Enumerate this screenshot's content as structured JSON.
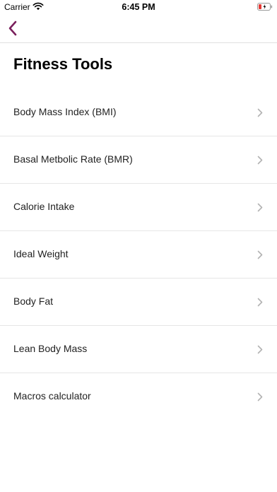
{
  "status_bar": {
    "carrier": "Carrier",
    "time": "6:45 PM"
  },
  "nav": {
    "back_icon": "chevron-left-icon",
    "accent_color": "#7a1f5c"
  },
  "title": "Fitness Tools",
  "tools": [
    {
      "label": "Body Mass Index (BMI)"
    },
    {
      "label": "Basal Metbolic Rate (BMR)"
    },
    {
      "label": "Calorie Intake"
    },
    {
      "label": "Ideal Weight"
    },
    {
      "label": "Body Fat"
    },
    {
      "label": "Lean Body Mass"
    },
    {
      "label": "Macros calculator"
    }
  ]
}
